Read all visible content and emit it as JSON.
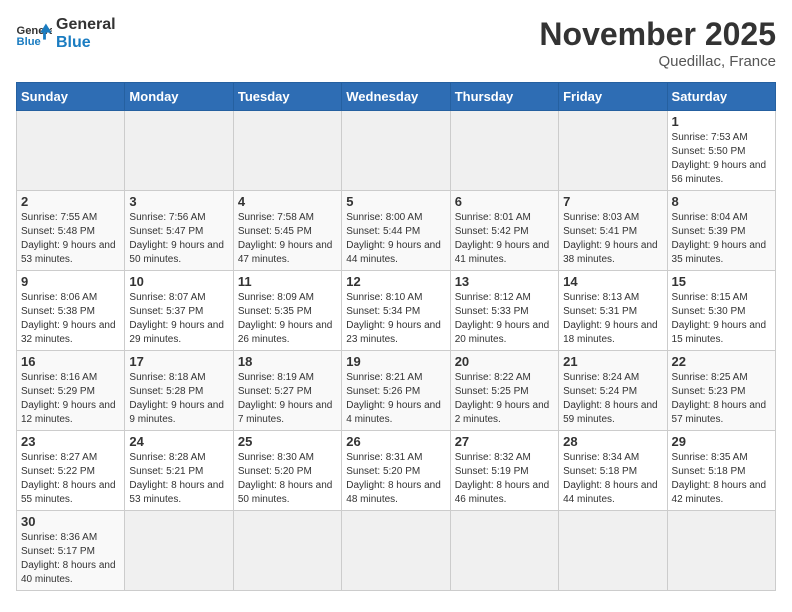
{
  "header": {
    "logo_general": "General",
    "logo_blue": "Blue",
    "month_title": "November 2025",
    "location": "Quedillac, France"
  },
  "days_of_week": [
    "Sunday",
    "Monday",
    "Tuesday",
    "Wednesday",
    "Thursday",
    "Friday",
    "Saturday"
  ],
  "weeks": [
    [
      {
        "day": "",
        "info": ""
      },
      {
        "day": "",
        "info": ""
      },
      {
        "day": "",
        "info": ""
      },
      {
        "day": "",
        "info": ""
      },
      {
        "day": "",
        "info": ""
      },
      {
        "day": "",
        "info": ""
      },
      {
        "day": "1",
        "info": "Sunrise: 7:53 AM\nSunset: 5:50 PM\nDaylight: 9 hours and 56 minutes."
      }
    ],
    [
      {
        "day": "2",
        "info": "Sunrise: 7:55 AM\nSunset: 5:48 PM\nDaylight: 9 hours and 53 minutes."
      },
      {
        "day": "3",
        "info": "Sunrise: 7:56 AM\nSunset: 5:47 PM\nDaylight: 9 hours and 50 minutes."
      },
      {
        "day": "4",
        "info": "Sunrise: 7:58 AM\nSunset: 5:45 PM\nDaylight: 9 hours and 47 minutes."
      },
      {
        "day": "5",
        "info": "Sunrise: 8:00 AM\nSunset: 5:44 PM\nDaylight: 9 hours and 44 minutes."
      },
      {
        "day": "6",
        "info": "Sunrise: 8:01 AM\nSunset: 5:42 PM\nDaylight: 9 hours and 41 minutes."
      },
      {
        "day": "7",
        "info": "Sunrise: 8:03 AM\nSunset: 5:41 PM\nDaylight: 9 hours and 38 minutes."
      },
      {
        "day": "8",
        "info": "Sunrise: 8:04 AM\nSunset: 5:39 PM\nDaylight: 9 hours and 35 minutes."
      }
    ],
    [
      {
        "day": "9",
        "info": "Sunrise: 8:06 AM\nSunset: 5:38 PM\nDaylight: 9 hours and 32 minutes."
      },
      {
        "day": "10",
        "info": "Sunrise: 8:07 AM\nSunset: 5:37 PM\nDaylight: 9 hours and 29 minutes."
      },
      {
        "day": "11",
        "info": "Sunrise: 8:09 AM\nSunset: 5:35 PM\nDaylight: 9 hours and 26 minutes."
      },
      {
        "day": "12",
        "info": "Sunrise: 8:10 AM\nSunset: 5:34 PM\nDaylight: 9 hours and 23 minutes."
      },
      {
        "day": "13",
        "info": "Sunrise: 8:12 AM\nSunset: 5:33 PM\nDaylight: 9 hours and 20 minutes."
      },
      {
        "day": "14",
        "info": "Sunrise: 8:13 AM\nSunset: 5:31 PM\nDaylight: 9 hours and 18 minutes."
      },
      {
        "day": "15",
        "info": "Sunrise: 8:15 AM\nSunset: 5:30 PM\nDaylight: 9 hours and 15 minutes."
      }
    ],
    [
      {
        "day": "16",
        "info": "Sunrise: 8:16 AM\nSunset: 5:29 PM\nDaylight: 9 hours and 12 minutes."
      },
      {
        "day": "17",
        "info": "Sunrise: 8:18 AM\nSunset: 5:28 PM\nDaylight: 9 hours and 9 minutes."
      },
      {
        "day": "18",
        "info": "Sunrise: 8:19 AM\nSunset: 5:27 PM\nDaylight: 9 hours and 7 minutes."
      },
      {
        "day": "19",
        "info": "Sunrise: 8:21 AM\nSunset: 5:26 PM\nDaylight: 9 hours and 4 minutes."
      },
      {
        "day": "20",
        "info": "Sunrise: 8:22 AM\nSunset: 5:25 PM\nDaylight: 9 hours and 2 minutes."
      },
      {
        "day": "21",
        "info": "Sunrise: 8:24 AM\nSunset: 5:24 PM\nDaylight: 8 hours and 59 minutes."
      },
      {
        "day": "22",
        "info": "Sunrise: 8:25 AM\nSunset: 5:23 PM\nDaylight: 8 hours and 57 minutes."
      }
    ],
    [
      {
        "day": "23",
        "info": "Sunrise: 8:27 AM\nSunset: 5:22 PM\nDaylight: 8 hours and 55 minutes."
      },
      {
        "day": "24",
        "info": "Sunrise: 8:28 AM\nSunset: 5:21 PM\nDaylight: 8 hours and 53 minutes."
      },
      {
        "day": "25",
        "info": "Sunrise: 8:30 AM\nSunset: 5:20 PM\nDaylight: 8 hours and 50 minutes."
      },
      {
        "day": "26",
        "info": "Sunrise: 8:31 AM\nSunset: 5:20 PM\nDaylight: 8 hours and 48 minutes."
      },
      {
        "day": "27",
        "info": "Sunrise: 8:32 AM\nSunset: 5:19 PM\nDaylight: 8 hours and 46 minutes."
      },
      {
        "day": "28",
        "info": "Sunrise: 8:34 AM\nSunset: 5:18 PM\nDaylight: 8 hours and 44 minutes."
      },
      {
        "day": "29",
        "info": "Sunrise: 8:35 AM\nSunset: 5:18 PM\nDaylight: 8 hours and 42 minutes."
      }
    ],
    [
      {
        "day": "30",
        "info": "Sunrise: 8:36 AM\nSunset: 5:17 PM\nDaylight: 8 hours and 40 minutes."
      },
      {
        "day": "",
        "info": ""
      },
      {
        "day": "",
        "info": ""
      },
      {
        "day": "",
        "info": ""
      },
      {
        "day": "",
        "info": ""
      },
      {
        "day": "",
        "info": ""
      },
      {
        "day": "",
        "info": ""
      }
    ]
  ]
}
